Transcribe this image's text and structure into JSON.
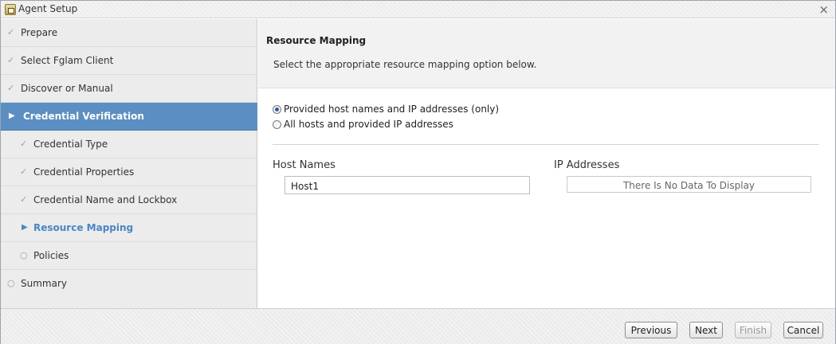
{
  "window": {
    "title": "Agent Setup",
    "close_glyph": "×",
    "app_icon": "agent-setup-icon"
  },
  "sidebar": {
    "items": [
      {
        "label": "Prepare",
        "icon": "check-icon",
        "glyph": "✓",
        "state": "done",
        "level": 0
      },
      {
        "label": "Select Fglam Client",
        "icon": "check-icon",
        "glyph": "✓",
        "state": "done",
        "level": 0
      },
      {
        "label": "Discover or Manual",
        "icon": "check-icon",
        "glyph": "✓",
        "state": "done",
        "level": 0
      },
      {
        "label": "Credential Verification",
        "icon": "triangle-right-icon",
        "glyph": "▶",
        "state": "active",
        "level": 0
      },
      {
        "label": "Credential Type",
        "icon": "check-icon",
        "glyph": "✓",
        "state": "done",
        "level": 1
      },
      {
        "label": "Credential Properties",
        "icon": "check-icon",
        "glyph": "✓",
        "state": "done",
        "level": 1
      },
      {
        "label": "Credential Name and Lockbox",
        "icon": "check-icon",
        "glyph": "✓",
        "state": "done",
        "level": 1
      },
      {
        "label": "Resource Mapping",
        "icon": "triangle-right-icon",
        "glyph": "▶",
        "state": "current",
        "level": 1
      },
      {
        "label": "Policies",
        "icon": "circle-icon",
        "glyph": "○",
        "state": "pending",
        "level": 1
      },
      {
        "label": "Summary",
        "icon": "circle-icon",
        "glyph": "○",
        "state": "pending",
        "level": 0
      }
    ]
  },
  "main": {
    "title": "Resource Mapping",
    "description": "Select the appropriate resource mapping option below.",
    "options": [
      {
        "label": "Provided host names and IP addresses (only)",
        "checked": true
      },
      {
        "label": "All hosts and provided IP addresses",
        "checked": false
      }
    ],
    "host_names": {
      "label": "Host Names",
      "value": "Host1"
    },
    "ip_addresses": {
      "label": "IP Addresses",
      "empty_text": "There Is No Data To Display"
    }
  },
  "footer": {
    "previous": "Previous",
    "next": "Next",
    "finish": "Finish",
    "cancel": "Cancel"
  },
  "colors": {
    "active_nav_bg": "#5b8fc4",
    "current_sub_text": "#4a86c6",
    "sidebar_bg": "#ececec"
  }
}
